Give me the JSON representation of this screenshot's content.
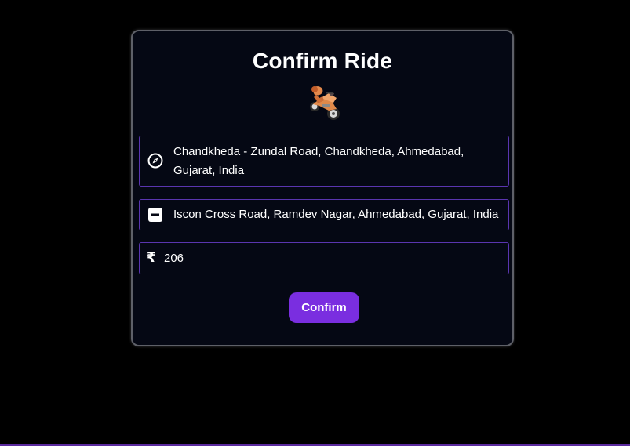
{
  "card": {
    "title": "Confirm Ride",
    "vehicle_icon": "motorbike-icon"
  },
  "pickup": {
    "icon": "pickup-location-icon",
    "address": "Chandkheda - Zundal Road, Chandkheda, Ahmedabad, Gujarat, India"
  },
  "destination": {
    "icon": "destination-square-icon",
    "address": "Iscon Cross Road, Ramdev Nagar, Ahmedabad, Gujarat, India"
  },
  "fare": {
    "currency_symbol": "₹",
    "amount": "206"
  },
  "actions": {
    "confirm_label": "Confirm"
  },
  "colors": {
    "background": "#000000",
    "card": "#050814",
    "accent": "#7a2ee0",
    "field_border": "#5a35b0"
  }
}
